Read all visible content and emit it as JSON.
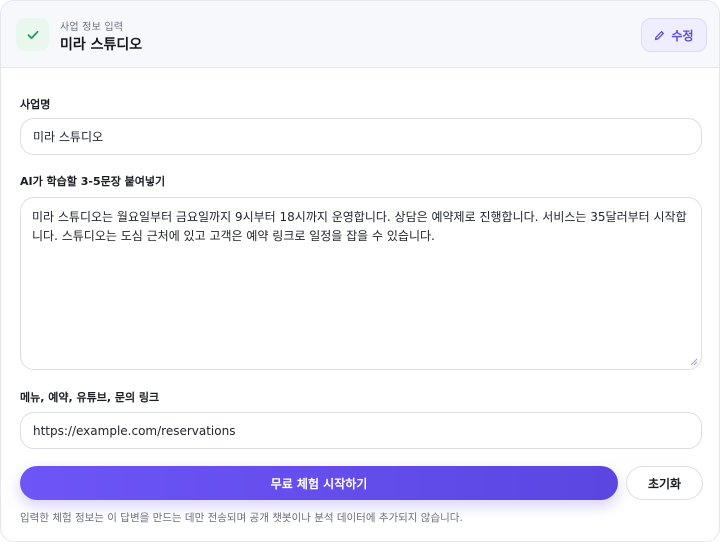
{
  "header": {
    "subtitle": "사업 정보 입력",
    "title": "미라 스튜디오",
    "edit_label": "수정"
  },
  "form": {
    "business_name": {
      "label": "사업명",
      "value": "미라 스튜디오"
    },
    "ai_sentences": {
      "label": "AI가 학습할 3-5문장 붙여넣기",
      "value": "미라 스튜디오는 월요일부터 금요일까지 9시부터 18시까지 운영합니다. 상담은 예약제로 진행합니다. 서비스는 35달러부터 시작합니다. 스튜디오는 도심 근처에 있고 고객은 예약 링크로 일정을 잡을 수 있습니다."
    },
    "links": {
      "label": "메뉴, 예약, 유튜브, 문의 링크",
      "value": "https://example.com/reservations"
    }
  },
  "actions": {
    "primary_label": "무료 체험 시작하기",
    "reset_label": "초기화"
  },
  "footnote": "입력한 체험 정보는 이 답변을 만드는 데만 전송되며 공개 챗봇이나 분석 데이터에 추가되지 않습니다.",
  "colors": {
    "accent": "#5b46e2",
    "success": "#1f9d55"
  },
  "icons": {
    "status": "check-icon",
    "edit": "pencil-icon"
  }
}
